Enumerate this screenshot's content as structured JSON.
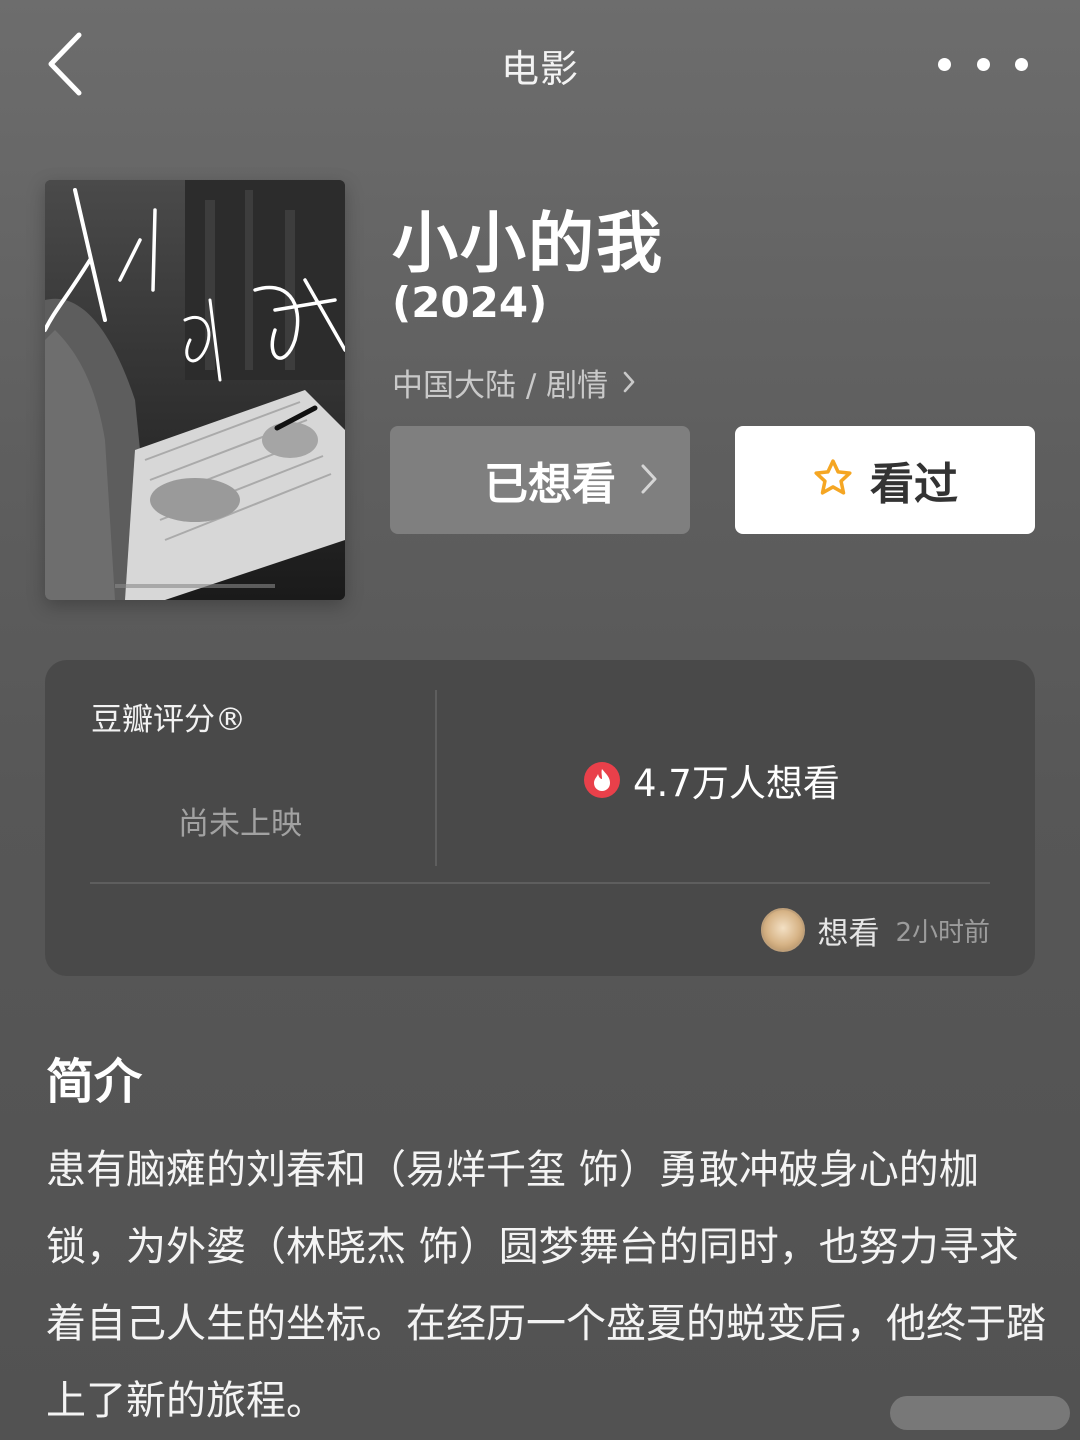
{
  "nav": {
    "title": "电影",
    "back_icon": "back-chevron-icon",
    "more_icon": "more-dots-icon"
  },
  "movie": {
    "title": "小小的我",
    "year": "(2024)",
    "meta": "中国大陆 / 剧情",
    "poster_title": "小小的我"
  },
  "actions": {
    "wish_label": "已想看",
    "seen_label": "看过",
    "seen_icon": "star-outline-icon",
    "star_color": "#f5a623"
  },
  "rating": {
    "label": "豆瓣评分®",
    "status": "尚未上映",
    "wish_count": "4.7万人想看",
    "fire_color": "#e9404a"
  },
  "activity": {
    "status": "想看",
    "time": "2小时前"
  },
  "intro": {
    "heading": "简介",
    "text": "患有脑瘫的刘春和（易烊千玺 饰）勇敢冲破身心的枷锁，为外婆（林晓杰 饰）圆梦舞台的同时，也努力寻求着自己人生的坐标。在经历一个盛夏的蜕变后，他终于踏上了新的旅程。"
  }
}
